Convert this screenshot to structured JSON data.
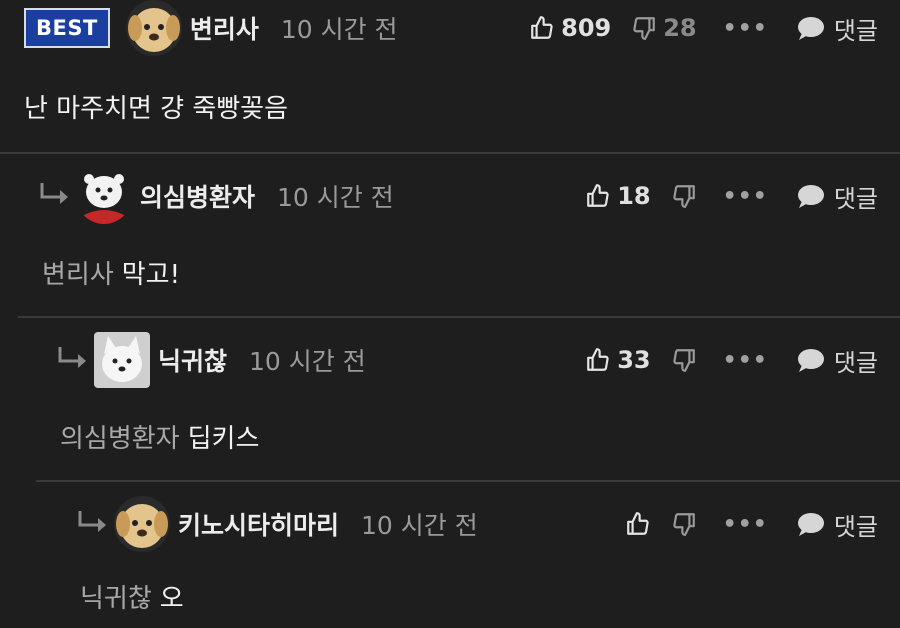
{
  "comments": [
    {
      "best_badge": "BEST",
      "nickname": "변리사",
      "time": "10 시간 전",
      "likes": "809",
      "dislikes": "28",
      "more": "•••",
      "reply_label": "댓글",
      "mention": "",
      "text": "난 마주치면 걍 죽빵꽂음"
    },
    {
      "nickname": "의심병환자",
      "time": "10 시간 전",
      "likes": "18",
      "dislikes": "",
      "more": "•••",
      "reply_label": "댓글",
      "mention": "변리사",
      "text": "막고!"
    },
    {
      "nickname": "닉귀찮",
      "time": "10 시간 전",
      "likes": "33",
      "dislikes": "",
      "more": "•••",
      "reply_label": "댓글",
      "mention": "의심병환자",
      "text": "딥키스"
    },
    {
      "nickname": "키노시타히마리",
      "time": "10 시간 전",
      "likes": "",
      "dislikes": "",
      "more": "•••",
      "reply_label": "댓글",
      "mention": "닉귀찮",
      "text": "오"
    }
  ],
  "colors": {
    "background": "#1e1e1f",
    "badge": "#1b3fa0",
    "divider": "#3a3a3c",
    "mention": "#a8a8a8"
  }
}
